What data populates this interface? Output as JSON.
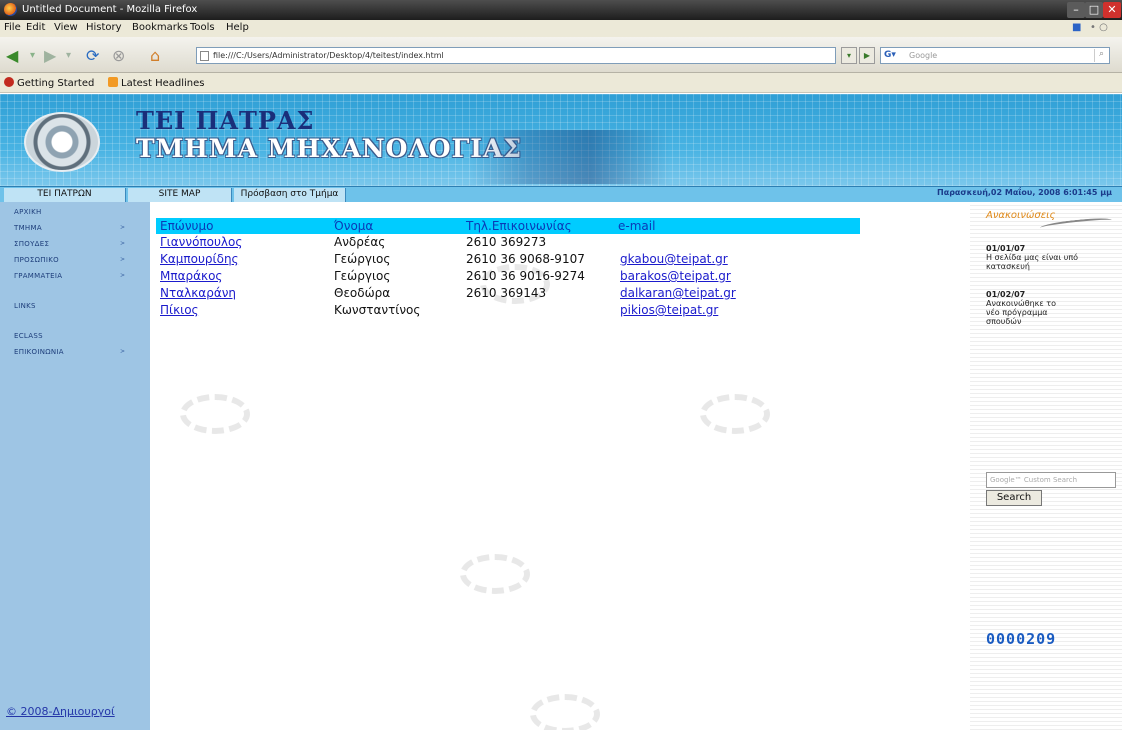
{
  "window": {
    "title": "Untitled Document - Mozilla Firefox"
  },
  "menu": {
    "items": [
      "File",
      "Edit",
      "View",
      "History",
      "Bookmarks",
      "Tools",
      "Help"
    ]
  },
  "toolbar": {
    "url": "file:///C:/Users/Administrator/Desktop/4/teitest/index.html",
    "search_placeholder": "Google"
  },
  "bookmarks": {
    "items": [
      "Getting Started",
      "Latest Headlines"
    ]
  },
  "site": {
    "brand_line1": "ΤΕΙ ΠΑΤΡΑΣ",
    "brand_line2": "ΤΜΗΜΑ ΜΗΧΑΝΟΛΟΓΙΑΣ",
    "tabs": [
      "ΤΕΙ ΠΑΤΡΩΝ",
      "SITE MAP",
      "Πρόσβαση στο Τμήμα"
    ],
    "date": "Παρασκευή,02 Μαΐου, 2008 6:01:45 μμ",
    "left_nav": [
      "ΑΡΧΙΚΗ",
      "ΤΜΗΜΑ",
      "ΣΠΟΥΔΕΣ",
      "ΠΡΟΣΩΠΙΚΟ",
      "ΓΡΑΜΜΑΤΕΙΑ",
      "LINKS",
      "ECLASS",
      "ΕΠΙΚΟΙΝΩΝΙΑ"
    ],
    "arrow": ">",
    "footer": "© 2008-Δημιουργοί"
  },
  "table": {
    "headers": [
      "Επώνυμο",
      "Όνομα",
      "Τηλ.Επικοινωνίας",
      "e-mail"
    ],
    "rows": [
      [
        "Γιαννόπουλος",
        "Ανδρέας",
        "2610 369273",
        ""
      ],
      [
        "Καμπουρίδης",
        "Γεώργιος",
        "2610 36 9068-9107",
        "gkabou@teipat.gr"
      ],
      [
        "Μπαράκος",
        "Γεώργιος",
        "2610 36 9016-9274",
        "barakos@teipat.gr"
      ],
      [
        "Νταλκαράνη",
        "Θεοδώρα",
        "2610 369143",
        "dalkaran@teipat.gr"
      ],
      [
        "Πίκιος",
        "Κωνσταντίνος",
        "",
        "pikios@teipat.gr"
      ]
    ]
  },
  "news": {
    "heading": "Ανακοινώσεις",
    "items": [
      {
        "date": "01/01/07",
        "text": "Η σελίδα μας είναι υπό κατασκευή"
      },
      {
        "date": "01/02/07",
        "text": "Ανακοινώθηκε το νέο πρόγραμμα σπουδών"
      }
    ],
    "search_placeholder": "Google™ Custom Search",
    "search_button": "Search",
    "counter": "0000209"
  }
}
